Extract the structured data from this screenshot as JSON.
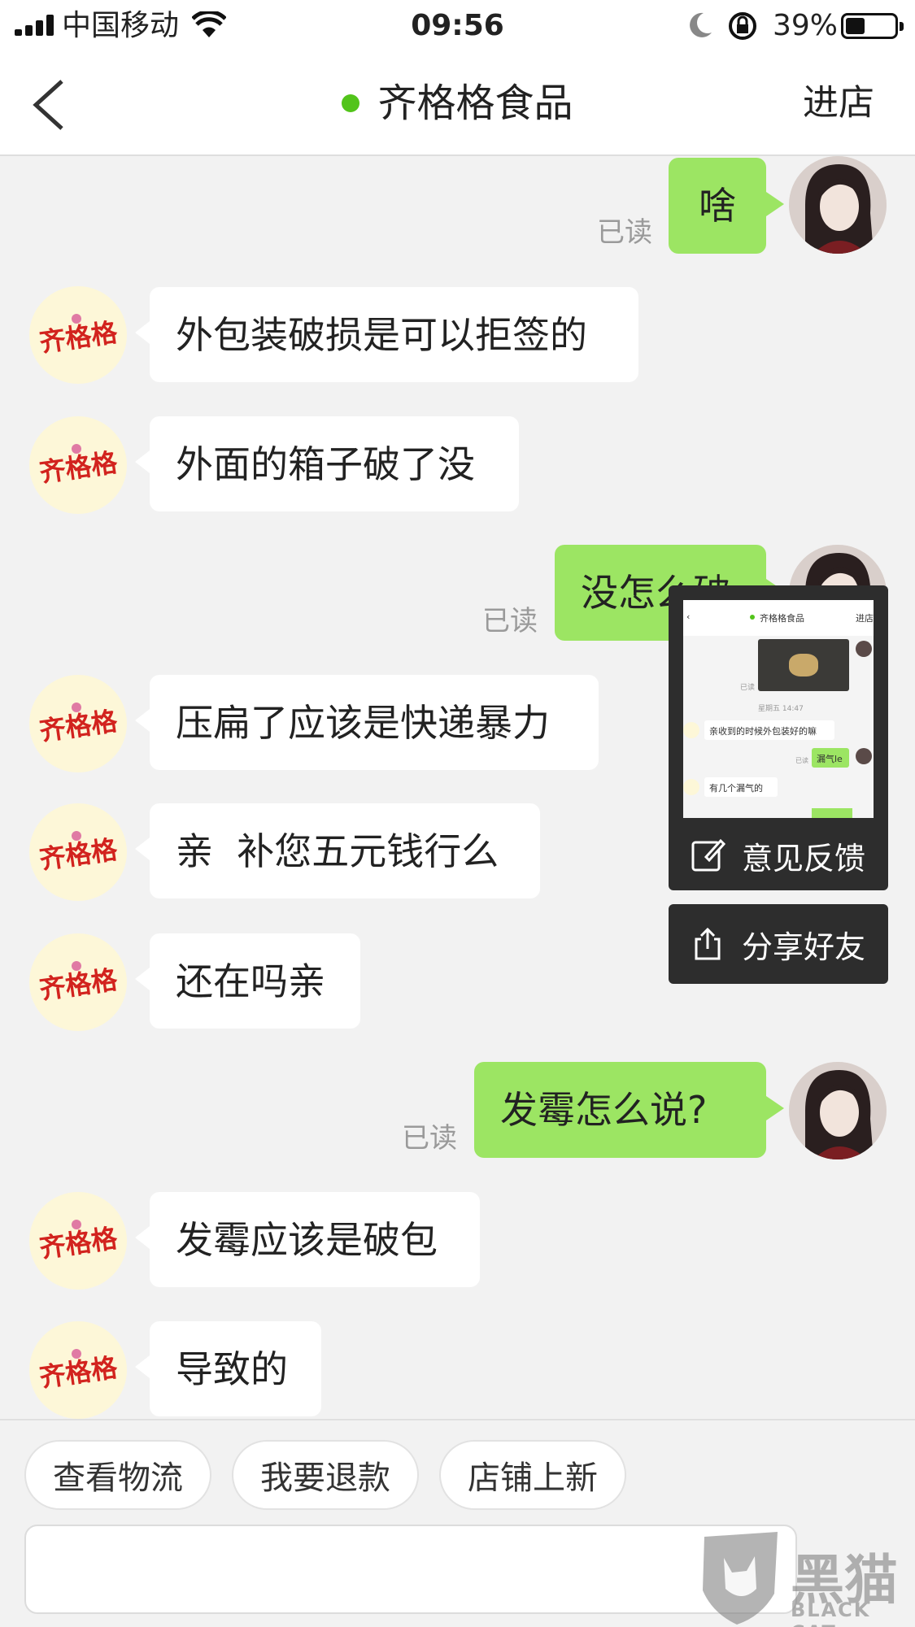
{
  "status_bar": {
    "carrier": "中国移动",
    "time": "09:56",
    "battery_percent_text": "39%",
    "battery_level": 0.39
  },
  "nav": {
    "title": "齐格格食品",
    "shop_button": "进店",
    "online_color": "#52c41a"
  },
  "messages": [
    {
      "side": "right",
      "text": "啥",
      "read": "已读"
    },
    {
      "side": "left",
      "text": "外包装破损是可以拒签的"
    },
    {
      "side": "left",
      "text": "外面的箱子破了没"
    },
    {
      "side": "right",
      "text": "没怎么破",
      "read": "已读"
    },
    {
      "side": "left",
      "text": "压扁了应该是快递暴力"
    },
    {
      "side": "left",
      "text": "亲  补您五元钱行么"
    },
    {
      "side": "left",
      "text": "还在吗亲"
    },
    {
      "side": "right",
      "text": "发霉怎么说?",
      "read": "已读"
    },
    {
      "side": "left",
      "text": "发霉应该是破包"
    },
    {
      "side": "left",
      "text": "导致的"
    }
  ],
  "shop_avatar_text": "齐格格",
  "float_panel": {
    "thumb_title": "齐格格食品",
    "thumb_shop": "进店",
    "thumb_time": "星期五 14:47",
    "thumb_msg1": "亲收到的时候外包装好的嘛",
    "thumb_msg2": "漏气le",
    "thumb_msg3": "有几个漏气的",
    "thumb_read": "已读",
    "feedback_label": "意见反馈",
    "share_label": "分享好友"
  },
  "quick_replies": [
    "查看物流",
    "我要退款",
    "店铺上新"
  ],
  "watermark": {
    "text": "黑猫",
    "sub": "BLACK CAT"
  },
  "colors": {
    "bubble_right": "#9ce563",
    "bubble_left": "#ffffff",
    "background": "#f2f2f2"
  }
}
